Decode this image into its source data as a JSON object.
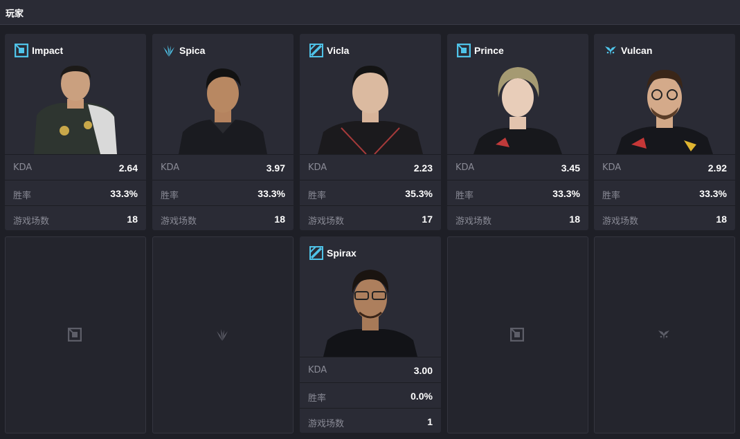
{
  "header": {
    "title": "玩家"
  },
  "labels": {
    "kda": "KDA",
    "winrate": "胜率",
    "games": "游戏场数"
  },
  "colors": {
    "accent": "#4fc3e8",
    "panel": "#2a2b35",
    "background": "#1e1f26"
  },
  "players": [
    {
      "name": "Impact",
      "team_icon": "square-logo-icon",
      "kda": "2.64",
      "winrate": "33.3%",
      "games": "18"
    },
    {
      "name": "Spica",
      "team_icon": "wing-logo-icon",
      "kda": "3.97",
      "winrate": "33.3%",
      "games": "18"
    },
    {
      "name": "Vicla",
      "team_icon": "slash-logo-icon",
      "kda": "2.23",
      "winrate": "35.3%",
      "games": "17"
    },
    {
      "name": "Prince",
      "team_icon": "square-logo-icon",
      "kda": "3.45",
      "winrate": "33.3%",
      "games": "18"
    },
    {
      "name": "Vulcan",
      "team_icon": "bird-logo-icon",
      "kda": "2.92",
      "winrate": "33.3%",
      "games": "18"
    },
    {
      "name": "Spirax",
      "team_icon": "slash-logo-icon",
      "kda": "3.00",
      "winrate": "0.0%",
      "games": "1"
    }
  ],
  "empty_slots": [
    "square-logo-icon",
    "wing-logo-icon",
    "square-logo-icon",
    "bird-logo-icon"
  ]
}
